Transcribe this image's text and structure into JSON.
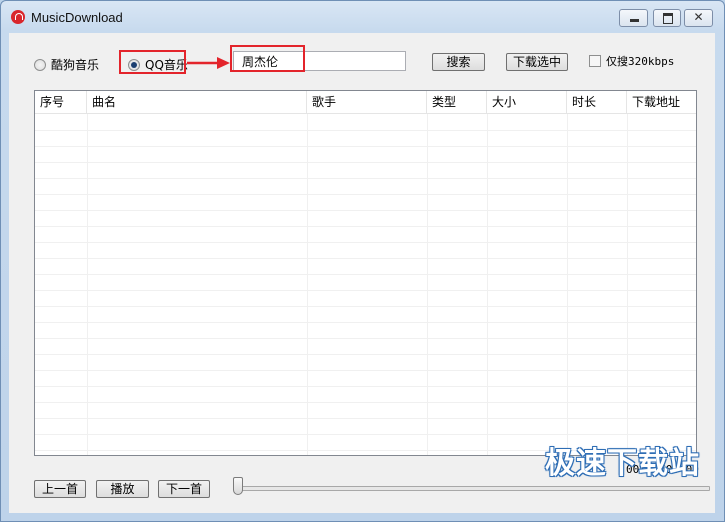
{
  "window": {
    "title": "MusicDownload",
    "controls": {
      "minimize": "",
      "maximize": "",
      "close": "✕"
    }
  },
  "source": {
    "option_kugou": "酷狗音乐",
    "option_qq": "QQ音乐",
    "selected": "QQ音乐"
  },
  "search": {
    "value": "周杰伦",
    "search_button": "搜索",
    "download_selected_button": "下载选中",
    "only_320_label": "仅搜320kbps",
    "only_320_checked": false
  },
  "list": {
    "columns": [
      "序号",
      "曲名",
      "歌手",
      "类型",
      "大小",
      "时长",
      "下载地址"
    ],
    "rows": []
  },
  "player": {
    "prev_button": "上一首",
    "play_button": "播放",
    "next_button": "下一首",
    "time": "00:00/00:00",
    "progress": 0
  },
  "watermark": "极速下载站",
  "colors": {
    "highlight": "#e3242b",
    "accent": "#1c3f70"
  }
}
